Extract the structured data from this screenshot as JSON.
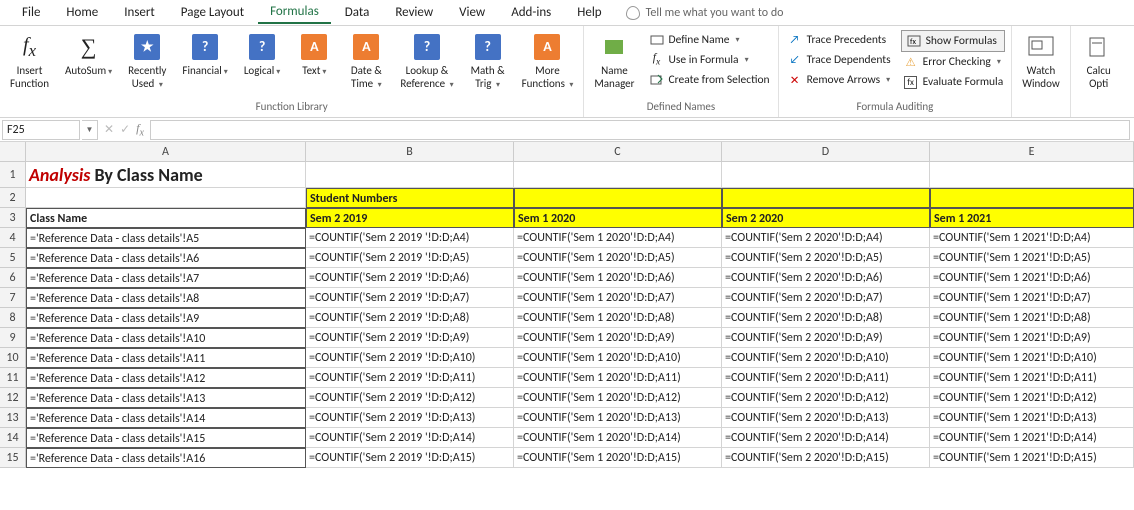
{
  "menu": [
    "File",
    "Home",
    "Insert",
    "Page Layout",
    "Formulas",
    "Data",
    "Review",
    "View",
    "Add-ins",
    "Help"
  ],
  "menu_active": 4,
  "tellme": "Tell me what you want to do",
  "ribbon": {
    "function_library": {
      "title": "Function Library",
      "buttons": [
        {
          "label": "Insert\nFunction",
          "icon": "fx"
        },
        {
          "label": "AutoSum",
          "icon": "sigma",
          "caret": true
        },
        {
          "label": "Recently\nUsed ",
          "icon": "star",
          "caret": true
        },
        {
          "label": "Financial",
          "icon": "sq",
          "caret": true
        },
        {
          "label": "Logical",
          "icon": "sq",
          "caret": true
        },
        {
          "label": "Text",
          "icon": "orange",
          "caret": true
        },
        {
          "label": "Date &\nTime ",
          "icon": "orange",
          "caret": true
        },
        {
          "label": "Lookup &\nReference ",
          "icon": "sq",
          "caret": true
        },
        {
          "label": "Math &\nTrig ",
          "icon": "sq",
          "caret": true
        },
        {
          "label": "More\nFunctions ",
          "icon": "orange",
          "caret": true
        }
      ]
    },
    "defined_names": {
      "title": "Defined Names",
      "main": {
        "label": "Name\nManager"
      },
      "items": [
        "Define Name ",
        "Use in Formula ",
        "Create from Selection"
      ]
    },
    "formula_auditing": {
      "title": "Formula Auditing",
      "left": [
        "Trace Precedents",
        "Trace Dependents",
        "Remove Arrows "
      ],
      "right": [
        "Show Formulas",
        "Error Checking ",
        "Evaluate Formula"
      ]
    },
    "watch": {
      "label": "Watch\nWindow"
    },
    "calc": {
      "label": "Calcu\nOpti"
    }
  },
  "namebox": "F25",
  "columns": [
    "A",
    "B",
    "C",
    "D",
    "E"
  ],
  "title_cell": {
    "red": "Analysis",
    "rest": " By Class Name"
  },
  "row2": {
    "b": "Student Numbers"
  },
  "row3": {
    "a": "Class Name",
    "b": "Sem 2 2019",
    "c": "Sem 1 2020",
    "d": "Sem 2 2020",
    "e": "Sem 1 2021"
  },
  "data": [
    {
      "r": 4,
      "a": "='Reference Data - class details'!A5",
      "b": "=COUNTIF('Sem 2 2019 '!D:D;A4)",
      "c": "=COUNTIF('Sem 1 2020'!D:D;A4)",
      "d": "=COUNTIF('Sem 2 2020'!D:D;A4)",
      "e": "=COUNTIF('Sem 1 2021'!D:D;A4)"
    },
    {
      "r": 5,
      "a": "='Reference Data - class details'!A6",
      "b": "=COUNTIF('Sem 2 2019 '!D:D;A5)",
      "c": "=COUNTIF('Sem 1 2020'!D:D;A5)",
      "d": "=COUNTIF('Sem 2 2020'!D:D;A5)",
      "e": "=COUNTIF('Sem 1 2021'!D:D;A5)"
    },
    {
      "r": 6,
      "a": "='Reference Data - class details'!A7",
      "b": "=COUNTIF('Sem 2 2019 '!D:D;A6)",
      "c": "=COUNTIF('Sem 1 2020'!D:D;A6)",
      "d": "=COUNTIF('Sem 2 2020'!D:D;A6)",
      "e": "=COUNTIF('Sem 1 2021'!D:D;A6)"
    },
    {
      "r": 7,
      "a": "='Reference Data - class details'!A8",
      "b": "=COUNTIF('Sem 2 2019 '!D:D;A7)",
      "c": "=COUNTIF('Sem 1 2020'!D:D;A7)",
      "d": "=COUNTIF('Sem 2 2020'!D:D;A7)",
      "e": "=COUNTIF('Sem 1 2021'!D:D;A7)"
    },
    {
      "r": 8,
      "a": "='Reference Data - class details'!A9",
      "b": "=COUNTIF('Sem 2 2019 '!D:D;A8)",
      "c": "=COUNTIF('Sem 1 2020'!D:D;A8)",
      "d": "=COUNTIF('Sem 2 2020'!D:D;A8)",
      "e": "=COUNTIF('Sem 1 2021'!D:D;A8)"
    },
    {
      "r": 9,
      "a": "='Reference Data - class details'!A10",
      "b": "=COUNTIF('Sem 2 2019 '!D:D;A9)",
      "c": "=COUNTIF('Sem 1 2020'!D:D;A9)",
      "d": "=COUNTIF('Sem 2 2020'!D:D;A9)",
      "e": "=COUNTIF('Sem 1 2021'!D:D;A9)"
    },
    {
      "r": 10,
      "a": "='Reference Data - class details'!A11",
      "b": "=COUNTIF('Sem 2 2019 '!D:D;A10)",
      "c": "=COUNTIF('Sem 1 2020'!D:D;A10)",
      "d": "=COUNTIF('Sem 2 2020'!D:D;A10)",
      "e": "=COUNTIF('Sem 1 2021'!D:D;A10)"
    },
    {
      "r": 11,
      "a": "='Reference Data - class details'!A12",
      "b": "=COUNTIF('Sem 2 2019 '!D:D;A11)",
      "c": "=COUNTIF('Sem 1 2020'!D:D;A11)",
      "d": "=COUNTIF('Sem 2 2020'!D:D;A11)",
      "e": "=COUNTIF('Sem 1 2021'!D:D;A11)"
    },
    {
      "r": 12,
      "a": "='Reference Data - class details'!A13",
      "b": "=COUNTIF('Sem 2 2019 '!D:D;A12)",
      "c": "=COUNTIF('Sem 1 2020'!D:D;A12)",
      "d": "=COUNTIF('Sem 2 2020'!D:D;A12)",
      "e": "=COUNTIF('Sem 1 2021'!D:D;A12)"
    },
    {
      "r": 13,
      "a": "='Reference Data - class details'!A14",
      "b": "=COUNTIF('Sem 2 2019 '!D:D;A13)",
      "c": "=COUNTIF('Sem 1 2020'!D:D;A13)",
      "d": "=COUNTIF('Sem 2 2020'!D:D;A13)",
      "e": "=COUNTIF('Sem 1 2021'!D:D;A13)"
    },
    {
      "r": 14,
      "a": "='Reference Data - class details'!A15",
      "b": "=COUNTIF('Sem 2 2019 '!D:D;A14)",
      "c": "=COUNTIF('Sem 1 2020'!D:D;A14)",
      "d": "=COUNTIF('Sem 2 2020'!D:D;A14)",
      "e": "=COUNTIF('Sem 1 2021'!D:D;A14)"
    },
    {
      "r": 15,
      "a": "='Reference Data - class details'!A16",
      "b": "=COUNTIF('Sem 2 2019 '!D:D;A15)",
      "c": "=COUNTIF('Sem 1 2020'!D:D;A15)",
      "d": "=COUNTIF('Sem 2 2020'!D:D;A15)",
      "e": "=COUNTIF('Sem 1 2021'!D:D;A15)"
    }
  ]
}
